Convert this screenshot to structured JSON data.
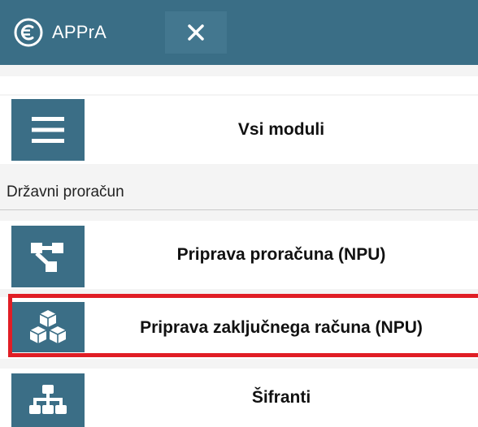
{
  "app": {
    "title": "APPrA",
    "logo_icon": "euro-circle-icon",
    "close_icon": "close-icon"
  },
  "colors": {
    "header_bg": "#3a6e86",
    "tile_bg": "#3b6e86",
    "highlight": "#e01e25"
  },
  "menu": {
    "all_modules": {
      "label": "Vsi moduli",
      "icon": "hamburger-menu-icon"
    },
    "section_title": "Državni proračun",
    "items": [
      {
        "label": "Priprava proračuna (NPU)",
        "icon": "flow-nodes-icon"
      },
      {
        "label": "Priprava zaključnega računa (NPU)",
        "icon": "cubes-icon",
        "highlighted": true
      },
      {
        "label": "Šifranti",
        "icon": "hierarchy-icon"
      }
    ]
  }
}
